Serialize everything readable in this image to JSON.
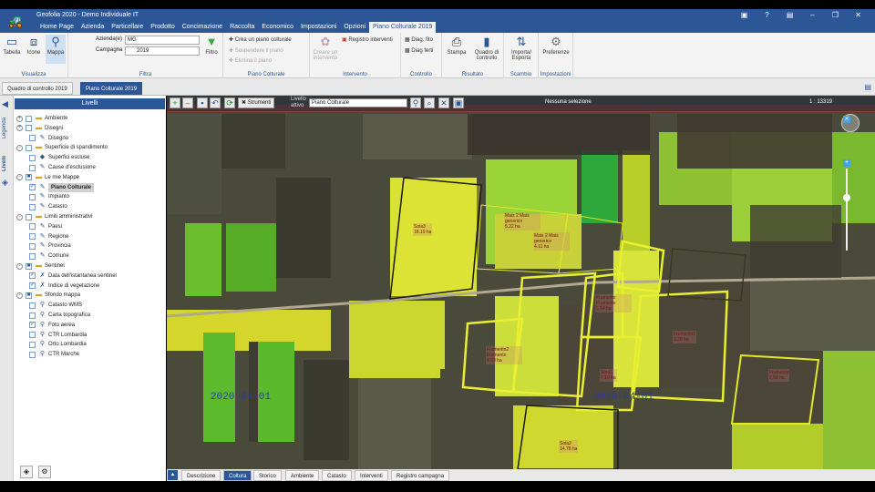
{
  "app": {
    "title": "Geofolia 2020 - Demo Individuale IT"
  },
  "menu": [
    "Home Page",
    "Azienda",
    "Particellare",
    "Prodotto",
    "Concimazione",
    "Raccolta",
    "Economico",
    "Impostazioni",
    "Opzioni",
    "Piano Colturale 2019"
  ],
  "ribbon": {
    "visualizza": {
      "label": "Visualizza",
      "tabella": "Tabella",
      "icone": "Icone",
      "mappa": "Mappa"
    },
    "filtra": {
      "label": "Filtra",
      "azienda_label": "Azienda(e)",
      "azienda_value": "MG",
      "campagna_label": "Campagna",
      "campagna_value": "2019",
      "filtro": "Filtro"
    },
    "piano": {
      "label": "Piano Colturale",
      "crea": "Crea un piano colturale",
      "sospendi": "Sospendere il piano",
      "elimina": "Elimina il piano"
    },
    "interventi": {
      "label": "Intervento",
      "creare": "Creare un intervento",
      "registro": "Registro interventi"
    },
    "controllo": {
      "label": "Controllo",
      "diag_fito": "Diag. fito",
      "diag_ferti": "Diag ferti"
    },
    "risultato": {
      "label": "Risultato",
      "stampa": "Stampa",
      "quadro": "Quadro di controllo"
    },
    "scambio": {
      "label": "Scambio",
      "importa": "Importa/ Esporta"
    },
    "impostazioni": {
      "label": "Impostazioni",
      "preferenze": "Preferenze"
    }
  },
  "doc_tabs": [
    "Quadro di controllo 2019",
    "Piano Colturale 2019"
  ],
  "sidebar": {
    "strip_legenda": "Legenda",
    "strip_livelli": "Livelli",
    "header": "Livelli",
    "items": [
      {
        "label": "Ambiente",
        "level": 0,
        "exp": "+",
        "chk": "",
        "ico": "▬"
      },
      {
        "label": "Disegni",
        "level": 0,
        "exp": "+",
        "chk": "",
        "ico": "▬"
      },
      {
        "label": "Disegno",
        "level": 1,
        "exp": "",
        "chk": "",
        "ico": "✎"
      },
      {
        "label": "Superficie di spandimento",
        "level": 0,
        "exp": "-",
        "chk": "",
        "ico": "▬"
      },
      {
        "label": "Superfici escluse",
        "level": 1,
        "exp": "",
        "chk": "",
        "ico": "◆"
      },
      {
        "label": "Cause d'esclusione",
        "level": 1,
        "exp": "",
        "chk": "",
        "ico": "✎"
      },
      {
        "label": "Le mie Mappe",
        "level": 0,
        "exp": "-",
        "chk": "■",
        "ico": "▬"
      },
      {
        "label": "Piano Colturale",
        "level": 1,
        "exp": "",
        "chk": "✓",
        "ico": "✎",
        "sel": true
      },
      {
        "label": "Impianto",
        "level": 1,
        "exp": "",
        "chk": "",
        "ico": "✎"
      },
      {
        "label": "Catasto",
        "level": 1,
        "exp": "",
        "chk": "",
        "ico": "✎"
      },
      {
        "label": "Limiti amministrativi",
        "level": 0,
        "exp": "-",
        "chk": "",
        "ico": "▬"
      },
      {
        "label": "Paesi",
        "level": 1,
        "exp": "",
        "chk": "",
        "ico": "✎"
      },
      {
        "label": "Regione",
        "level": 1,
        "exp": "",
        "chk": "",
        "ico": "✎"
      },
      {
        "label": "Provincia",
        "level": 1,
        "exp": "",
        "chk": "",
        "ico": "✎"
      },
      {
        "label": "Comune",
        "level": 1,
        "exp": "",
        "chk": "",
        "ico": "✎"
      },
      {
        "label": "Sentinel",
        "level": 0,
        "exp": "-",
        "chk": "■",
        "ico": "▬"
      },
      {
        "label": "Data dell'istantanea sentinel",
        "level": 1,
        "exp": "",
        "chk": "✓",
        "ico": "✗"
      },
      {
        "label": "Indice di vegetazione",
        "level": 1,
        "exp": "",
        "chk": "✓",
        "ico": "✗"
      },
      {
        "label": "Sfondo mappa",
        "level": 0,
        "exp": "-",
        "chk": "■",
        "ico": "▬"
      },
      {
        "label": "Catasto WMS",
        "level": 1,
        "exp": "",
        "chk": "",
        "ico": "⚲"
      },
      {
        "label": "Carta topografica",
        "level": 1,
        "exp": "",
        "chk": "",
        "ico": "⚲"
      },
      {
        "label": "Foto aerea",
        "level": 1,
        "exp": "",
        "chk": "✓",
        "ico": "⚲"
      },
      {
        "label": "CTR Lombardia",
        "level": 1,
        "exp": "",
        "chk": "",
        "ico": "⚲"
      },
      {
        "label": "Orto Lombardia",
        "level": 1,
        "exp": "",
        "chk": "",
        "ico": "⚲"
      },
      {
        "label": "CTR Marche",
        "level": 1,
        "exp": "",
        "chk": "",
        "ico": "⚲"
      }
    ]
  },
  "map": {
    "strumenti": "Strumenti",
    "livello_label": "Livello attivo",
    "livello_value": "Piano Colturale",
    "selection": "Nessuna selezione",
    "scale": "1 : 13319",
    "dates": [
      "2020-04-01",
      "2020-04-01"
    ],
    "parcels": [
      {
        "name": "Soia3",
        "area": "18.19 ha"
      },
      {
        "name": "Mais 2 Mais generico",
        "area": "5.22 ha"
      },
      {
        "name": "Mais 2 Mais generico",
        "area": "4.11 ha"
      },
      {
        "name": "Frumento Frumento",
        "area": "5.54 ha"
      },
      {
        "name": "Frumento2 Frumento",
        "area": "4.58 ha"
      },
      {
        "name": "Soia1",
        "area": "7.10 ha"
      },
      {
        "name": "Frumento3",
        "area": "3.28 ha"
      },
      {
        "name": "Soia2",
        "area": "14.78 ha"
      },
      {
        "name": "Frumento",
        "area": "2.98 ha"
      }
    ]
  },
  "bottom_tabs": [
    "Descrizione",
    "Coltura",
    "Storico",
    "Ambiente",
    "Catasto",
    "Interventi",
    "Registro campagna"
  ]
}
